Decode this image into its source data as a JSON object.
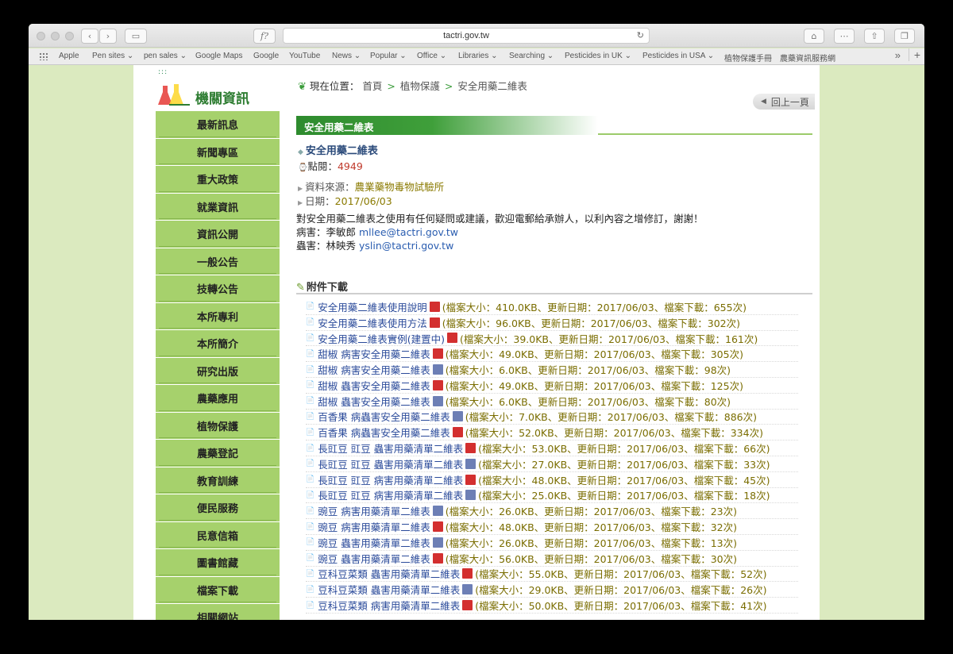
{
  "browser": {
    "url": "tactri.gov.tw",
    "bookmarks": [
      "Apple",
      "Pen sites ⌄",
      "pen sales ⌄",
      "Google Maps",
      "Google",
      "YouTube",
      "News ⌄",
      "Popular ⌄",
      "Office ⌄",
      "Libraries ⌄",
      "Searching ⌄",
      "Pesticides in UK ⌄",
      "Pesticides in USA ⌄",
      "植物保護手冊",
      "農藥資訊服務網"
    ]
  },
  "sidebar": {
    "title": "機關資訊",
    "items": [
      "最新訊息",
      "新聞專區",
      "重大政策",
      "就業資訊",
      "資訊公開",
      "一般公告",
      "技轉公告",
      "本所專利",
      "本所簡介",
      "研究出版",
      "農藥應用",
      "植物保護",
      "農藥登記",
      "教育訓練",
      "便民服務",
      "民意信箱",
      "圖書館藏",
      "檔案下載",
      "相關網站"
    ]
  },
  "breadcrumb": {
    "label": "現在位置：",
    "items": [
      "首頁",
      "植物保護",
      "安全用藥二維表"
    ]
  },
  "back_button": "回上一頁",
  "banner": "安全用藥二維表",
  "article": {
    "title": "安全用藥二維表",
    "hits_label": "點閱：",
    "hits": "4949",
    "source_label": "資料來源：",
    "source": "農業藥物毒物試驗所",
    "date_label": "日期：",
    "date": "2017/06/03",
    "intro": "對安全用藥二維表之使用有任何疑問或建議，歡迎電郵給承辦人，以利內容之增修訂，謝謝！",
    "contact1_label": "病害：李敏郎",
    "contact1_email": "mllee@tactri.gov.tw",
    "contact2_label": "蟲害：林映秀",
    "contact2_email": "yslin@tactri.gov.tw"
  },
  "attachments": {
    "heading": "附件下載",
    "files": [
      {
        "name": "安全用藥二維表使用說明",
        "type": "pdf",
        "meta": "(檔案大小：410.0KB、更新日期：2017/06/03、檔案下載：655次)"
      },
      {
        "name": "安全用藥二維表使用方法",
        "type": "pdf",
        "meta": "(檔案大小：96.0KB、更新日期：2017/06/03、檔案下載：302次)"
      },
      {
        "name": "安全用藥二維表實例(建置中)",
        "type": "pdf",
        "meta": "(檔案大小：39.0KB、更新日期：2017/06/03、檔案下載：161次)"
      },
      {
        "name": "甜椒 病害安全用藥二維表",
        "type": "pdf",
        "meta": "(檔案大小：49.0KB、更新日期：2017/06/03、檔案下載：305次)"
      },
      {
        "name": "甜椒 病害安全用藥二維表",
        "type": "odt",
        "meta": "(檔案大小：6.0KB、更新日期：2017/06/03、檔案下載：98次)"
      },
      {
        "name": "甜椒 蟲害安全用藥二維表",
        "type": "pdf",
        "meta": "(檔案大小：49.0KB、更新日期：2017/06/03、檔案下載：125次)"
      },
      {
        "name": "甜椒 蟲害安全用藥二維表",
        "type": "odt",
        "meta": "(檔案大小：6.0KB、更新日期：2017/06/03、檔案下載：80次)"
      },
      {
        "name": "百香果 病蟲害安全用藥二維表",
        "type": "odt",
        "meta": "(檔案大小：7.0KB、更新日期：2017/06/03、檔案下載：886次)"
      },
      {
        "name": "百香果 病蟲害安全用藥二維表",
        "type": "pdf",
        "meta": "(檔案大小：52.0KB、更新日期：2017/06/03、檔案下載：334次)"
      },
      {
        "name": "長豇豆 豇豆 蟲害用藥清單二維表",
        "type": "pdf",
        "meta": "(檔案大小：53.0KB、更新日期：2017/06/03、檔案下載：66次)"
      },
      {
        "name": "長豇豆 豇豆 蟲害用藥清單二維表",
        "type": "odt",
        "meta": "(檔案大小：27.0KB、更新日期：2017/06/03、檔案下載：33次)"
      },
      {
        "name": "長豇豆 豇豆 病害用藥清單二維表",
        "type": "pdf",
        "meta": "(檔案大小：48.0KB、更新日期：2017/06/03、檔案下載：45次)"
      },
      {
        "name": "長豇豆 豇豆 病害用藥清單二維表",
        "type": "odt",
        "meta": "(檔案大小：25.0KB、更新日期：2017/06/03、檔案下載：18次)"
      },
      {
        "name": "豌豆 病害用藥清單二維表",
        "type": "odt",
        "meta": "(檔案大小：26.0KB、更新日期：2017/06/03、檔案下載：23次)"
      },
      {
        "name": "豌豆 病害用藥清單二維表",
        "type": "pdf",
        "meta": "(檔案大小：48.0KB、更新日期：2017/06/03、檔案下載：32次)"
      },
      {
        "name": "豌豆 蟲害用藥清單二維表",
        "type": "odt",
        "meta": "(檔案大小：26.0KB、更新日期：2017/06/03、檔案下載：13次)"
      },
      {
        "name": "豌豆 蟲害用藥清單二維表",
        "type": "pdf",
        "meta": "(檔案大小：56.0KB、更新日期：2017/06/03、檔案下載：30次)"
      },
      {
        "name": "豆科豆菜類 蟲害用藥清單二維表",
        "type": "pdf",
        "meta": "(檔案大小：55.0KB、更新日期：2017/06/03、檔案下載：52次)"
      },
      {
        "name": "豆科豆菜類 蟲害用藥清單二維表",
        "type": "odt",
        "meta": "(檔案大小：29.0KB、更新日期：2017/06/03、檔案下載：26次)"
      },
      {
        "name": "豆科豆菜類 病害用藥清單二維表",
        "type": "pdf",
        "meta": "(檔案大小：50.0KB、更新日期：2017/06/03、檔案下載：41次)"
      }
    ]
  }
}
